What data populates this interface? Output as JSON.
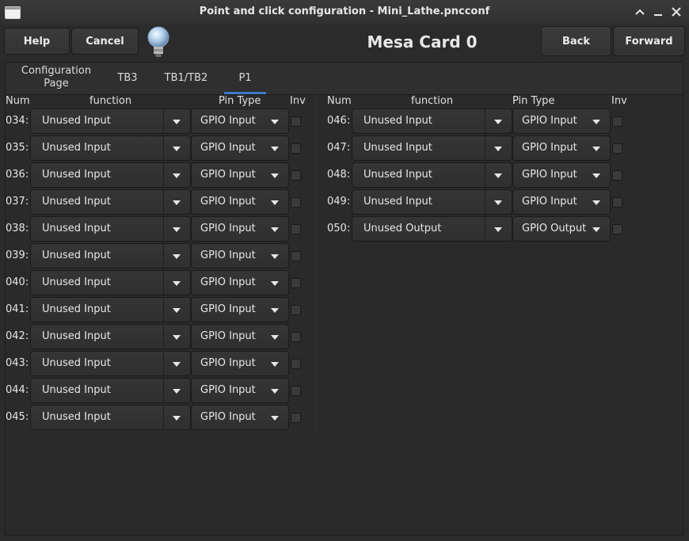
{
  "window": {
    "title": "Point and click configuration - Mini_Lathe.pncconf"
  },
  "toolbar": {
    "help": "Help",
    "cancel": "Cancel",
    "back": "Back",
    "forward": "Forward",
    "page_title": "Mesa Card 0"
  },
  "tabs": [
    {
      "label": "Configuration\nPage",
      "active": false
    },
    {
      "label": "TB3",
      "active": false
    },
    {
      "label": "TB1/TB2",
      "active": false
    },
    {
      "label": "P1",
      "active": true
    }
  ],
  "columns": {
    "num": "Num",
    "function": "function",
    "pin_type": "Pin Type",
    "inv": "Inv"
  },
  "left_pins": [
    {
      "num": "034:",
      "function": "Unused Input",
      "pin_type": "GPIO Input",
      "inv": false
    },
    {
      "num": "035:",
      "function": "Unused Input",
      "pin_type": "GPIO Input",
      "inv": false
    },
    {
      "num": "036:",
      "function": "Unused Input",
      "pin_type": "GPIO Input",
      "inv": false
    },
    {
      "num": "037:",
      "function": "Unused Input",
      "pin_type": "GPIO Input",
      "inv": false
    },
    {
      "num": "038:",
      "function": "Unused Input",
      "pin_type": "GPIO Input",
      "inv": false
    },
    {
      "num": "039:",
      "function": "Unused Input",
      "pin_type": "GPIO Input",
      "inv": false
    },
    {
      "num": "040:",
      "function": "Unused Input",
      "pin_type": "GPIO Input",
      "inv": false
    },
    {
      "num": "041:",
      "function": "Unused Input",
      "pin_type": "GPIO Input",
      "inv": false
    },
    {
      "num": "042:",
      "function": "Unused Input",
      "pin_type": "GPIO Input",
      "inv": false
    },
    {
      "num": "043:",
      "function": "Unused Input",
      "pin_type": "GPIO Input",
      "inv": false
    },
    {
      "num": "044:",
      "function": "Unused Input",
      "pin_type": "GPIO Input",
      "inv": false
    },
    {
      "num": "045:",
      "function": "Unused Input",
      "pin_type": "GPIO Input",
      "inv": false
    }
  ],
  "right_pins": [
    {
      "num": "046:",
      "function": "Unused Input",
      "pin_type": "GPIO Input",
      "inv": false
    },
    {
      "num": "047:",
      "function": "Unused Input",
      "pin_type": "GPIO Input",
      "inv": false
    },
    {
      "num": "048:",
      "function": "Unused Input",
      "pin_type": "GPIO Input",
      "inv": false
    },
    {
      "num": "049:",
      "function": "Unused Input",
      "pin_type": "GPIO Input",
      "inv": false
    },
    {
      "num": "050:",
      "function": "Unused Output",
      "pin_type": "GPIO Output",
      "inv": false
    }
  ],
  "icons": {
    "window": "window-icon",
    "minimize": "minimize-icon",
    "maximize": "maximize-icon",
    "close": "close-icon",
    "help_bulb": "lightbulb-icon"
  },
  "colors": {
    "accent": "#3b7ac7",
    "background": "#2b2b2b"
  }
}
